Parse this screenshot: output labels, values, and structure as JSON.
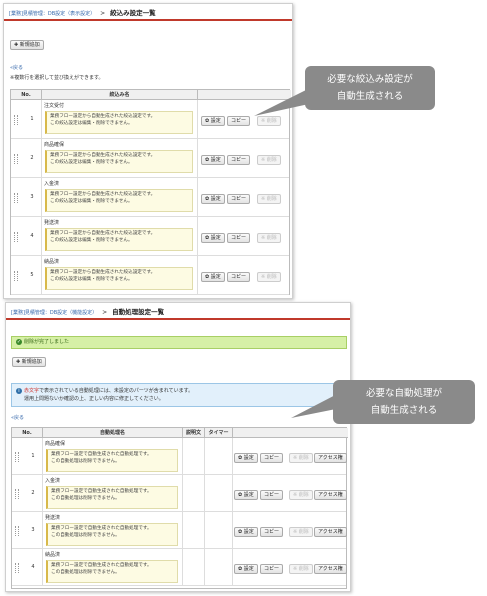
{
  "panel1": {
    "breadcrumb": "[業務]見積管理：DB設定（表示設定）",
    "separator": ">",
    "title": "絞込み設定一覧",
    "new_button": "✚ 新規追加",
    "back_link": "«戻る",
    "sort_note": "※複数行を選択して並び換えができます。",
    "columns": [
      "No.",
      "絞込み名"
    ],
    "box_line1": "業務フロー設定から自動生成された絞込設定です。",
    "box_line2": "この絞込設定は編集・削除できません。",
    "settings_button": "✿ 設定",
    "copy_button": "コピー",
    "delete_button": "※ 削除",
    "rows": [
      {
        "no": "1",
        "name": "注文受付"
      },
      {
        "no": "2",
        "name": "商品確保"
      },
      {
        "no": "3",
        "name": "入金済"
      },
      {
        "no": "4",
        "name": "発送済"
      },
      {
        "no": "5",
        "name": "納品済"
      }
    ]
  },
  "panel2": {
    "breadcrumb": "[業務]見積管理：DB設定（機能設定）",
    "separator": ">",
    "title": "自動処理設定一覧",
    "success_message": "削除が完了しました",
    "new_button": "✚ 新規追加",
    "info_line1_red": "赤文字",
    "info_line1_rest": "で表示されている自動処理には、未設定のパーツが含まれています。",
    "info_line2": "運用上問題ないか確認の上、正しい内容に修正してください。",
    "back_link": "«戻る",
    "columns": [
      "No.",
      "自動処理名",
      "説明文",
      "タイマー"
    ],
    "box_line1": "業務フロー設定で自動生成された自動処理です。",
    "box_line2": "この自動処理は削除できません。",
    "settings_button": "✿ 設定",
    "copy_button": "コピー",
    "delete_button": "※ 削除",
    "access_button": "アクセス権",
    "rows": [
      {
        "no": "1",
        "name": "商品確保"
      },
      {
        "no": "2",
        "name": "入金済"
      },
      {
        "no": "3",
        "name": "発送済"
      },
      {
        "no": "4",
        "name": "納品済"
      }
    ]
  },
  "callout1": {
    "line1": "必要な絞込み設定が",
    "line2": "自動生成される"
  },
  "callout2": {
    "line1": "必要な自動処理が",
    "line2": "自動生成される"
  },
  "colors": {
    "accent_red": "#c0392b",
    "success_bg": "#d6f0a6",
    "info_bg": "#e2f0fb",
    "callout_bg": "#8a8a8a",
    "note_bg": "#fdfbe3"
  },
  "icons": {
    "success": "check-circle-icon",
    "info": "info-circle-icon",
    "drag": "drag-handle-icon"
  }
}
